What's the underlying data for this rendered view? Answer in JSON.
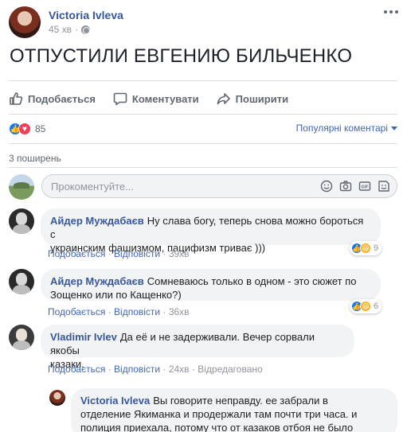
{
  "post": {
    "author": "Victoria Ivleva",
    "time": "45 хв",
    "text": "ОТПУСТИЛИ ЕВГЕНИЮ БИЛЬЧЕНКО"
  },
  "actions": {
    "like": "Подобається",
    "comment": "Коментувати",
    "share": "Поширити"
  },
  "reactions": {
    "count": "85",
    "sort_label": "Популярні коментарі"
  },
  "shares_label": "3 поширень",
  "comment_input": {
    "placeholder": "Прокоментуйте..."
  },
  "comments": [
    {
      "author": "Айдер Муждабаєв",
      "text_line1": "Ну слава богу, теперь снова можно бороться с",
      "text_line2": "украинским фашизмом, пацифизм триває )))",
      "like_label": "Подобається",
      "reply_label": "Відповісти",
      "time": "39хв",
      "reaction_count": "9"
    },
    {
      "author": "Айдер Муждабаєв",
      "text_line1": "Сомневаюсь только в одном - это сюжет по",
      "text_line2": "Зощенко или по Кащенко?)",
      "like_label": "Подобається",
      "reply_label": "Відповісти",
      "time": "36хв",
      "reaction_count": "6"
    },
    {
      "author": "Vladimir Ivlev",
      "text_line1": "Да её и не задерживали. Вечер сорвали якобы",
      "text_line2": "казаки.",
      "like_label": "Подобається",
      "reply_label": "Відповісти",
      "time": "24хв",
      "edited": "Відредаговано"
    },
    {
      "author": "Victoria Ivleva",
      "text_line1": "Вы говорите неправду. ее забрали в",
      "text_line2": "отделение Якиманка и продержали там почти три часа. и",
      "text_line3": "полиция приехала, потому что от казаков отбоя не было"
    }
  ],
  "colors": {
    "link": "#385898",
    "like_blue": "#1877f2",
    "love_red": "#f33e58",
    "haha_yellow": "#f7b125"
  },
  "icons": [
    "globe-icon",
    "more-icon",
    "thumbs-up-icon",
    "comment-icon",
    "share-icon",
    "emoji-icon",
    "camera-icon",
    "gif-icon",
    "sticker-icon"
  ]
}
